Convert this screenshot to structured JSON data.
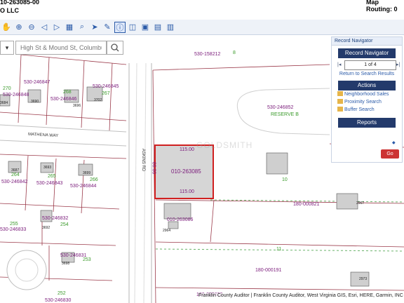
{
  "header": {
    "parcel_id_partial": "10-263085-00",
    "owner_partial": "O LLC",
    "map_routing_label": "Map Routing: 0"
  },
  "search": {
    "placeholder": "High St & Mound St, Columbus"
  },
  "toolbar": {
    "icons": [
      "pan-icon",
      "zoom-in-icon",
      "zoom-out-icon",
      "back-icon",
      "forward-icon",
      "print-icon",
      "zoom-box-icon",
      "select-icon",
      "measure-icon",
      "identify-icon",
      "buffer-icon",
      "parcel-icon",
      "layers-icon",
      "basemap-icon"
    ]
  },
  "record_navigator": {
    "header": "Record Navigator",
    "title": "Record Navigator",
    "position": "1 of 4",
    "return_link": "Return to Search Results",
    "actions_title": "Actions",
    "actions": [
      "Neighborhood Sales",
      "Proximity Search",
      "Buffer Search"
    ],
    "reports_title": "Reports",
    "go_label": "Go"
  },
  "map": {
    "street_label": "MATHENA WAY",
    "road_label": "ASKINS RD",
    "selected_parcel": "010-263085",
    "selected_dim_top": "115.00",
    "selected_dim_bottom": "115.00",
    "selected_dim_side": "60.00",
    "parcels_magenta": [
      "530-158212",
      "530-246847",
      "530-246848",
      "530-246846",
      "530-246845",
      "530-246852",
      "010-263086",
      "180-000821",
      "530-246842",
      "530-246843",
      "530-246844",
      "530-246832",
      "530-246833",
      "530-246831",
      "180-000191",
      "530-246830",
      "180-000822"
    ],
    "lot_numbers_green": [
      "8",
      "270",
      "268",
      "267",
      "264",
      "265",
      "266",
      "255",
      "254",
      "253",
      "252",
      "10",
      "11",
      "RESERVE B"
    ],
    "house_numbers": [
      "3684",
      "3690",
      "3696",
      "3702",
      "3687",
      "3693",
      "3699",
      "3692",
      "3698",
      "2964",
      "2967",
      "2973"
    ],
    "ownership_watermark": "GOLDSMITH"
  },
  "attribution": "Franklin County Auditor | Franklin County Auditor, West Virginia GIS, Esri, HERE, Garmin, INC"
}
